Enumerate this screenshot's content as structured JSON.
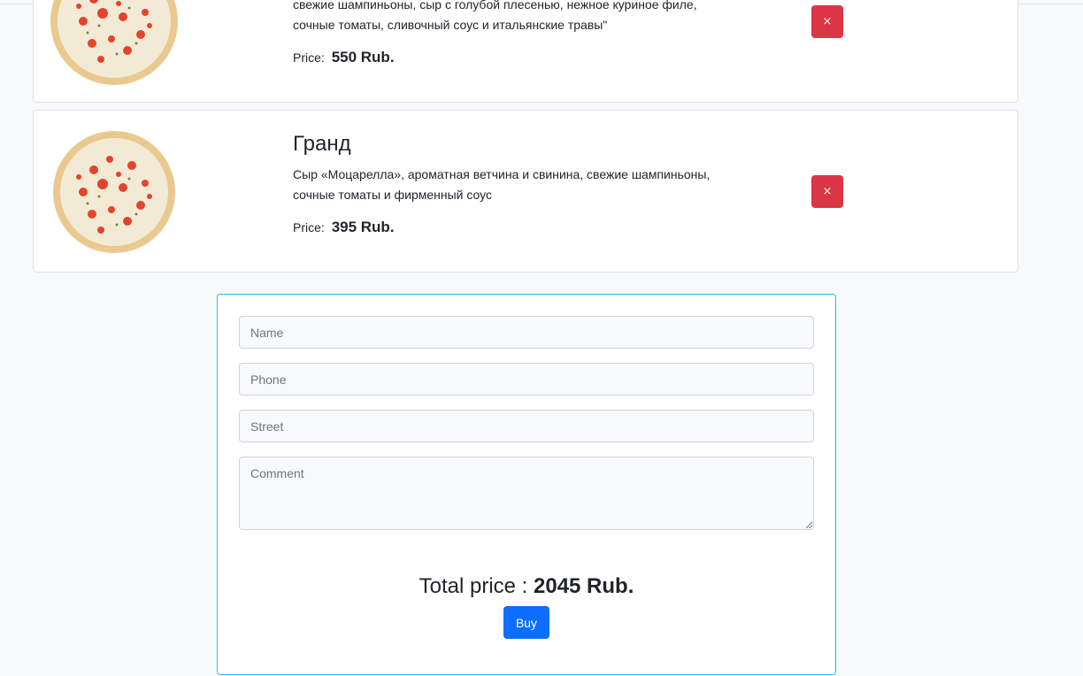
{
  "cart": {
    "items": [
      {
        "title": "",
        "description": "свежие шампиньоны, сыр с голубой плесенью, нежное куриное филе, сочные томаты, сливочный соус и итальянские травы\"",
        "price_label": "Price:",
        "price": "550 Rub.",
        "remove_label": "×",
        "image_icon": "pizza-image"
      },
      {
        "title": "Гранд",
        "description": "Сыр «Моцарелла», ароматная ветчина и свинина, свежие шампиньоны, сочные томаты и фирменный соус",
        "price_label": "Price:",
        "price": "395 Rub.",
        "remove_label": "×",
        "image_icon": "pizza-image"
      }
    ]
  },
  "order_form": {
    "name_placeholder": "Name",
    "phone_placeholder": "Phone",
    "street_placeholder": "Street",
    "comment_placeholder": "Comment",
    "total_label": "Total price :",
    "total_value": "2045 Rub.",
    "buy_label": "Buy"
  },
  "colors": {
    "danger": "#dc3545",
    "primary": "#0d6efd",
    "form_border": "#0dcaf0",
    "background": "#f8f9fa"
  }
}
